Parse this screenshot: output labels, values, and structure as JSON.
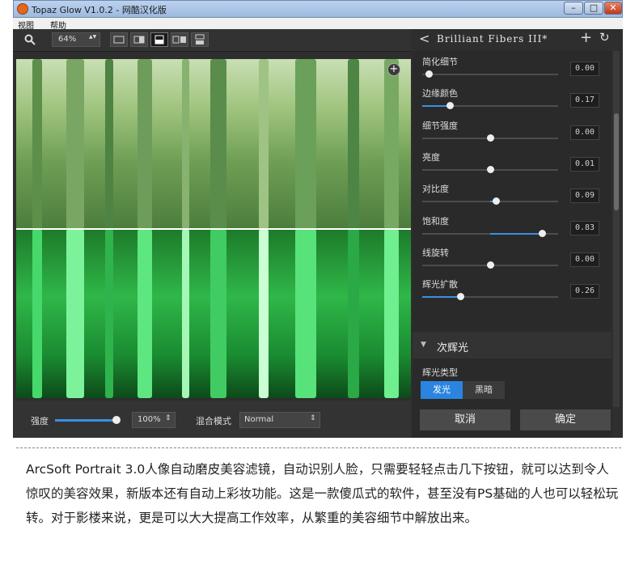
{
  "window": {
    "title": "Topaz Glow V1.0.2 - 网酷汉化版",
    "min": "–",
    "max": "□",
    "close": "✕"
  },
  "menu": {
    "items": [
      "视图",
      "帮助"
    ]
  },
  "toolbar": {
    "zoom": "64%",
    "zoom_arrows": "▲▼"
  },
  "canvas": {
    "add_symbol": "+"
  },
  "preset": {
    "name": "Brilliant Fibers III*",
    "back": "<",
    "add": "+",
    "reset": "↻"
  },
  "sliders": [
    {
      "label": "简化细节",
      "value": "0.00",
      "position": 0.05,
      "fill_from": 0.0,
      "fill_to": 0.0
    },
    {
      "label": "边缘颜色",
      "value": "0.17",
      "position": 0.2,
      "fill_from": 0.0,
      "fill_to": 0.2
    },
    {
      "label": "细节强度",
      "value": "0.00",
      "position": 0.5,
      "fill_from": 0.5,
      "fill_to": 0.5
    },
    {
      "label": "亮度",
      "value": "0.01",
      "position": 0.5,
      "fill_from": 0.5,
      "fill_to": 0.5
    },
    {
      "label": "对比度",
      "value": "0.09",
      "position": 0.54,
      "fill_from": 0.5,
      "fill_to": 0.54
    },
    {
      "label": "饱和度",
      "value": "0.83",
      "position": 0.88,
      "fill_from": 0.5,
      "fill_to": 0.88
    },
    {
      "label": "线旋转",
      "value": "0.00",
      "position": 0.5,
      "fill_from": 0.5,
      "fill_to": 0.5
    },
    {
      "label": "辉光扩散",
      "value": "0.26",
      "position": 0.28,
      "fill_from": 0.0,
      "fill_to": 0.28
    }
  ],
  "section": {
    "title": "次辉光",
    "arrow": "▼",
    "glow_type_label": "辉光类型",
    "glow_options": [
      "发光",
      "黑暗"
    ]
  },
  "bottom": {
    "strength_label": "强度",
    "strength_value": "100%",
    "strength_level": 0.95,
    "blend_label": "混合模式",
    "blend_value": "Normal",
    "spin": "⇕"
  },
  "actions": {
    "cancel": "取消",
    "ok": "确定"
  },
  "caption": "ArcSoft Portrait 3.0人像自动磨皮美容滤镜，自动识别人脸，只需要轻轻点击几下按钮，就可以达到令人惊叹的美容效果，新版本还有自动上彩妆功能。这是一款傻瓜式的软件，甚至没有PS基础的人也可以轻松玩转。对于影楼来说，更是可以大大提高工作效率，从繁重的美容细节中解放出来。",
  "colors": {
    "accent": "#2b84e0",
    "panel_bg": "#2a2a2a"
  }
}
